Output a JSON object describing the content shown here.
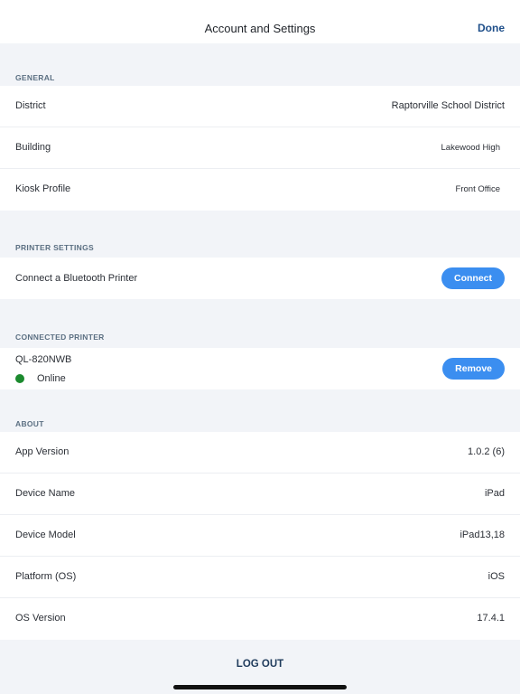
{
  "nav": {
    "title": "Account and Settings",
    "done_label": "Done"
  },
  "general": {
    "header": "GENERAL",
    "rows": [
      {
        "label": "District",
        "value": "Raptorville School District"
      },
      {
        "label": "Building",
        "value": "Lakewood High"
      },
      {
        "label": "Kiosk Profile",
        "value": "Front Office"
      }
    ]
  },
  "printer_settings": {
    "header": "PRINTER SETTINGS",
    "label": "Connect a Bluetooth Printer",
    "connect_label": "Connect"
  },
  "connected_printer": {
    "header": "CONNECTED PRINTER",
    "name": "QL-820NWB",
    "status": "Online",
    "remove_label": "Remove"
  },
  "about": {
    "header": "ABOUT",
    "rows": [
      {
        "label": "App Version",
        "value": "1.0.2 (6)"
      },
      {
        "label": "Device Name",
        "value": "iPad"
      },
      {
        "label": "Device Model",
        "value": "iPad13,18"
      },
      {
        "label": "Platform (OS)",
        "value": "iOS"
      },
      {
        "label": "OS Version",
        "value": "17.4.1"
      }
    ]
  },
  "logout_label": "LOG OUT",
  "colors": {
    "accent": "#3b8ef0",
    "online": "#1b8a2e",
    "done": "#1f4f8a"
  }
}
